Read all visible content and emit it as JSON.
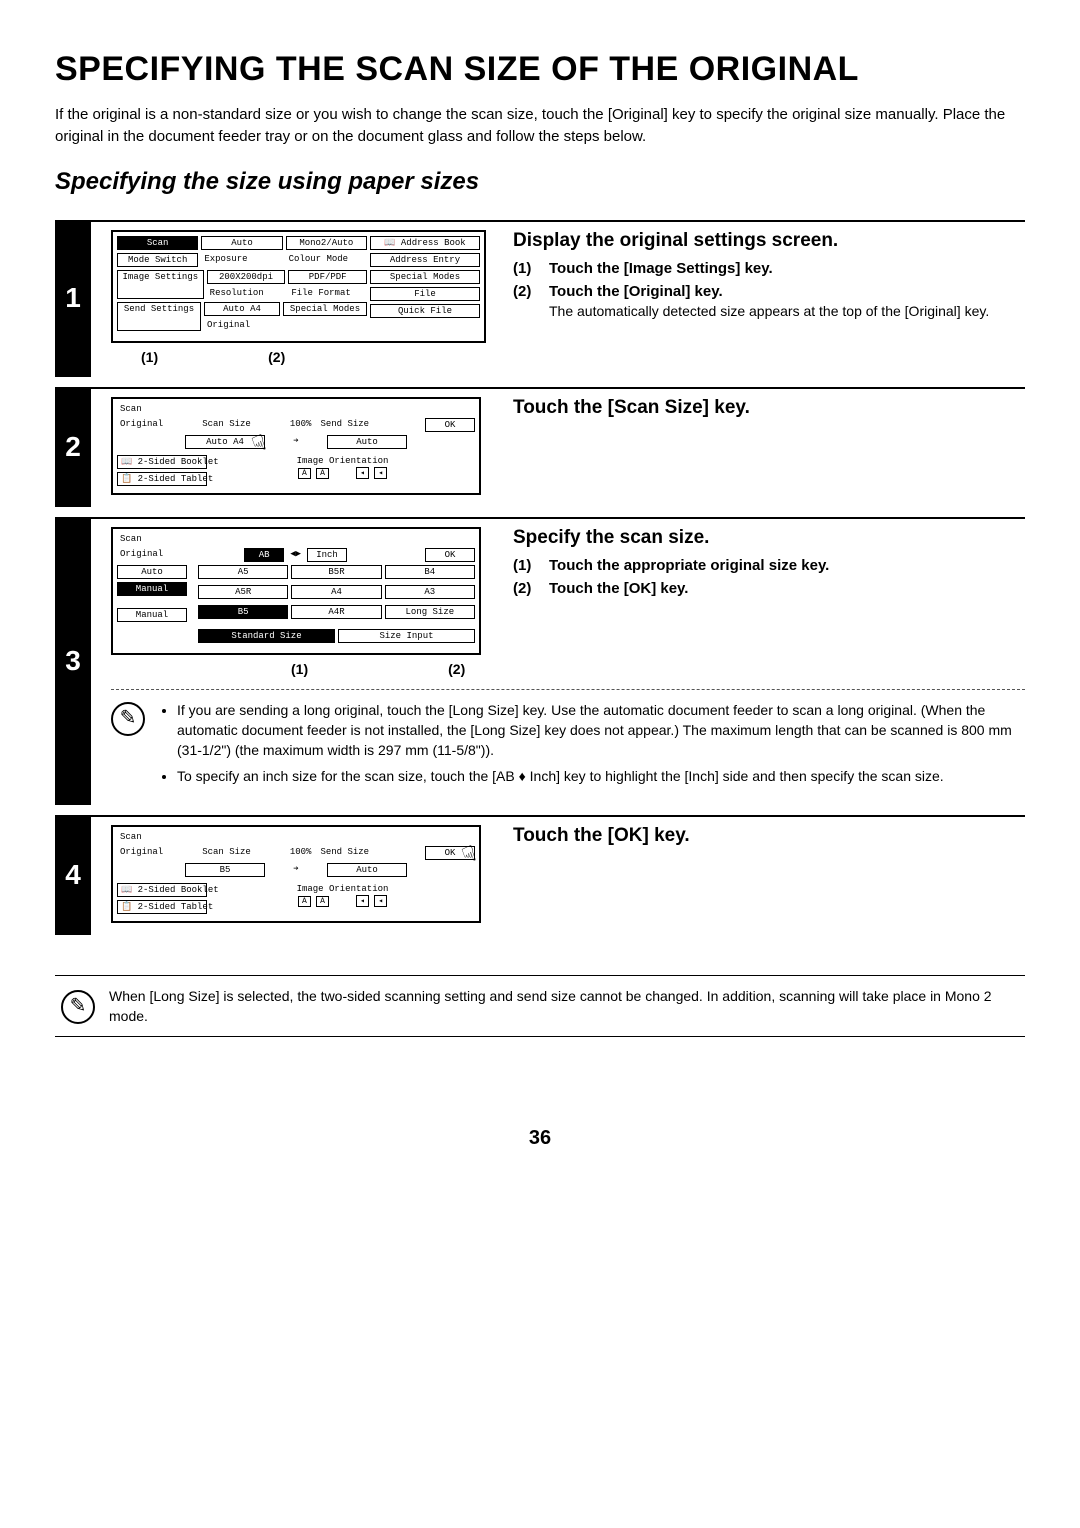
{
  "title": "SPECIFYING THE SCAN SIZE OF THE ORIGINAL",
  "intro": "If the original is a non-standard size or you wish to change the scan size, touch the [Original] key to specify the original size manually. Place the original in the document feeder tray or on the document glass and follow the steps below.",
  "subtitle": "Specifying the size using paper sizes",
  "step1": {
    "num": "1",
    "title": "Display the original settings screen.",
    "i1_num": "(1)",
    "i1": "Touch the [Image Settings] key.",
    "i2_num": "(2)",
    "i2": "Touch the [Original] key.",
    "note": "The automatically detected size appears at the top of the [Original] key.",
    "callout1": "(1)",
    "callout2": "(2)",
    "ui": {
      "scan": "Scan",
      "mode_switch": "Mode Switch",
      "auto": "Auto",
      "exposure": "Exposure",
      "mono": "Mono2/Auto",
      "colour": "Colour Mode",
      "image_settings": "Image Settings",
      "res_val": "200X200dpi",
      "resolution": "Resolution",
      "ff_val": "PDF/PDF",
      "file_format": "File Format",
      "send_settings": "Send Settings",
      "orig_val": "Auto  A4",
      "original": "Original",
      "special": "Special Modes",
      "addr_book": "Address Book",
      "addr_entry": "Address Entry",
      "special_modes": "Special Modes",
      "file": "File",
      "quick_file": "Quick File"
    }
  },
  "step2": {
    "num": "2",
    "title": "Touch the [Scan Size] key.",
    "ui": {
      "scan": "Scan",
      "original": "Original",
      "scan_size": "Scan Size",
      "pct": "100%",
      "send_size": "Send Size",
      "ok": "OK",
      "auto_a4": "Auto   A4",
      "arrow": "➔",
      "auto": "Auto",
      "two_booklet": "2-Sided Booklet",
      "two_tablet": "2-Sided Tablet",
      "img_orient": "Image Orientation"
    }
  },
  "step3": {
    "num": "3",
    "title": "Specify the scan size.",
    "i1_num": "(1)",
    "i1": "Touch the appropriate original size key.",
    "i2_num": "(2)",
    "i2": "Touch the [OK] key.",
    "callout1": "(1)",
    "callout2": "(2)",
    "note1": "If you are sending a long original, touch the [Long Size] key. Use the automatic document feeder to scan a long original. (When the automatic document feeder is not installed, the [Long Size] key does not appear.) The maximum length that can be scanned is 800 mm (31-1/2\") (the maximum width is 297 mm (11-5/8\")).",
    "note2": "To specify an inch size for the scan size, touch the [AB ♦ Inch] key to highlight the [Inch] side and then specify the scan size.",
    "ui": {
      "scan": "Scan",
      "original": "Original",
      "ab": "AB",
      "arrows": "◀▶",
      "inch": "Inch",
      "ok": "OK",
      "auto": "Auto",
      "manual_tab": "Manual",
      "manual": "Manual",
      "a5": "A5",
      "b5r": "B5R",
      "b4": "B4",
      "a5r": "A5R",
      "a4": "A4",
      "a3": "A3",
      "b5": "B5",
      "a4r": "A4R",
      "long": "Long Size",
      "std": "Standard Size",
      "size_input": "Size Input"
    }
  },
  "step4": {
    "num": "4",
    "title": "Touch the [OK] key.",
    "ui": {
      "scan": "Scan",
      "original": "Original",
      "scan_size": "Scan Size",
      "pct": "100%",
      "send_size": "Send Size",
      "ok": "OK",
      "b5": "B5",
      "arrow": "➔",
      "auto": "Auto",
      "two_booklet": "2-Sided Booklet",
      "two_tablet": "2-Sided Tablet",
      "img_orient": "Image Orientation"
    }
  },
  "footnote": "When [Long Size] is selected, the two-sided scanning setting and send size cannot be changed. In addition, scanning will take place in Mono 2 mode.",
  "page_num": "36"
}
